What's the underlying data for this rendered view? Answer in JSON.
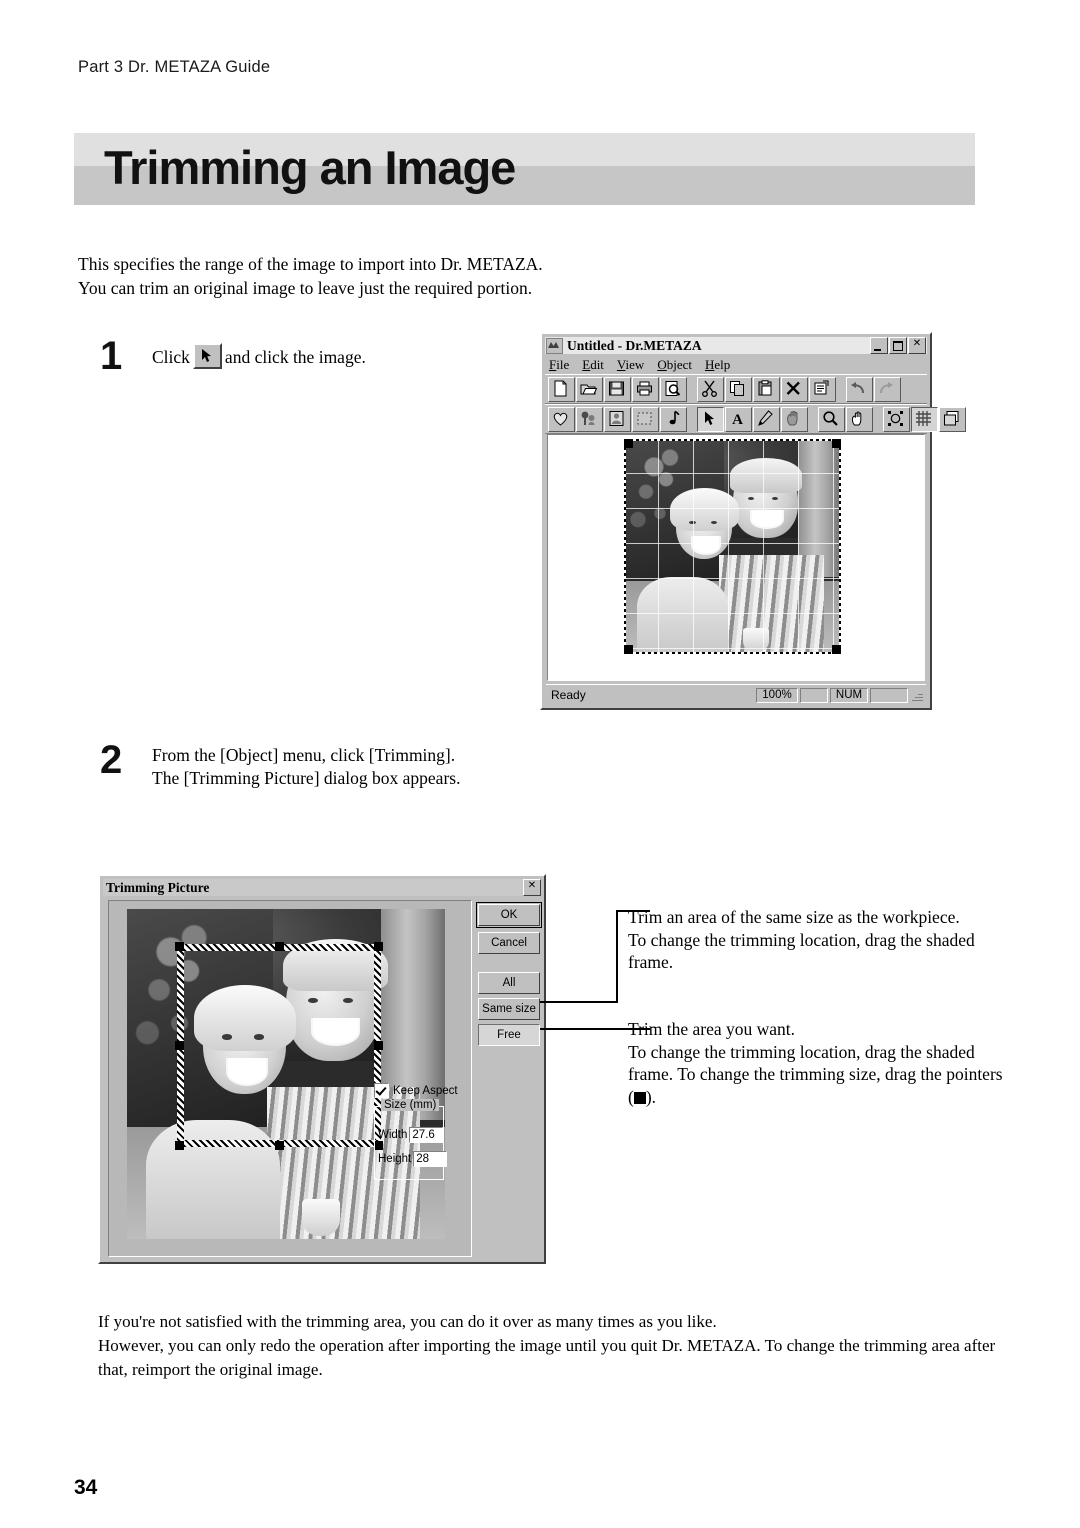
{
  "document": {
    "running_head": "Part 3  Dr. METAZA Guide",
    "title": "Trimming an Image",
    "page_number": "34",
    "intro": [
      "This specifies the range of the image to import into Dr. METAZA.",
      "You can trim an original image to leave just the required portion."
    ],
    "footnote": [
      "If you're not satisfied with the trimming area, you can do it over as many times as you like.",
      "However, you can only redo the operation after importing the image until you quit Dr. METAZA. To change the trimming area after",
      "that, reimport the original image."
    ]
  },
  "steps": [
    {
      "number": "1",
      "text_before": "Click",
      "text_after": "and click the image.",
      "icon": "arrow-pointer-icon"
    },
    {
      "number": "2",
      "lines": [
        "From the [Object] menu, click [Trimming].",
        "The [Trimming Picture] dialog box appears."
      ]
    }
  ],
  "app_window": {
    "title": "Untitled - Dr.METAZA",
    "app_icon": "metaza-icon",
    "window_buttons": [
      {
        "name": "minimize-button",
        "glyph": "_"
      },
      {
        "name": "maximize-button",
        "glyph": "▭"
      },
      {
        "name": "close-button",
        "glyph": "✕"
      }
    ],
    "menus": [
      {
        "label": "File",
        "accel": "F"
      },
      {
        "label": "Edit",
        "accel": "E"
      },
      {
        "label": "View",
        "accel": "V"
      },
      {
        "label": "Object",
        "accel": "O"
      },
      {
        "label": "Help",
        "accel": "H"
      }
    ],
    "toolbar_standard": [
      {
        "name": "new-icon"
      },
      {
        "name": "open-icon"
      },
      {
        "name": "save-icon"
      },
      {
        "name": "print-icon"
      },
      {
        "name": "print-preview-icon"
      },
      {
        "name": "cut-icon"
      },
      {
        "name": "copy-icon"
      },
      {
        "name": "paste-icon"
      },
      {
        "name": "delete-icon"
      },
      {
        "name": "properties-icon"
      },
      {
        "name": "undo-icon"
      },
      {
        "name": "redo-icon"
      }
    ],
    "toolbar_objects": [
      {
        "name": "heart-shape-icon"
      },
      {
        "name": "clipart-icon"
      },
      {
        "name": "image-icon"
      },
      {
        "name": "marquee-icon"
      },
      {
        "name": "music-note-icon"
      },
      {
        "name": "select-arrow-icon",
        "active": true
      },
      {
        "name": "text-tool-icon"
      },
      {
        "name": "pencil-tool-icon"
      },
      {
        "name": "hand-shape-icon"
      },
      {
        "name": "zoom-tool-icon"
      },
      {
        "name": "pan-tool-icon"
      },
      {
        "name": "workpiece-icon"
      },
      {
        "name": "grid-icon",
        "active": true
      },
      {
        "name": "layers-icon"
      }
    ],
    "status_bar": {
      "message": "Ready",
      "zoom": "100%",
      "num_lock": "NUM"
    }
  },
  "dialog": {
    "title": "Trimming Picture",
    "close_glyph": "✕",
    "buttons": [
      {
        "name": "ok-button",
        "label": "OK",
        "accel": "",
        "style": "default"
      },
      {
        "name": "cancel-button",
        "label": "Cancel",
        "accel": "",
        "style": "normal"
      },
      {
        "name": "all-button",
        "label": "All",
        "accel": "l",
        "style": "normal"
      },
      {
        "name": "same-size-button",
        "label": "Same size",
        "accel": "S",
        "style": "normal"
      },
      {
        "name": "free-button",
        "label": "Free",
        "accel": "F",
        "style": "pressed"
      }
    ],
    "keep_aspect": {
      "label": "Keep Aspect",
      "checked": true
    },
    "size_group": {
      "legend": "Size (mm)",
      "width": {
        "label": "Width",
        "value": "27.6"
      },
      "height": {
        "label": "Height",
        "value": "28"
      }
    }
  },
  "callouts": [
    {
      "target": "same-size-button",
      "lines": [
        "Trim an area of the same size as the workpiece.",
        "To change the trimming location, drag the shaded",
        "frame."
      ]
    },
    {
      "target": "free-button",
      "lines": [
        "Trim the area you want.",
        "To change the trimming location, drag the shaded",
        "frame. To change the trimming size, drag the pointers"
      ],
      "last_line_prefix": "(",
      "last_line_suffix": ")."
    }
  ],
  "colors": {
    "window_face": "#c0c0c0",
    "title_band_light": "#e0e0e0",
    "title_band_dark": "#c6c6c6",
    "text": "#000000"
  }
}
